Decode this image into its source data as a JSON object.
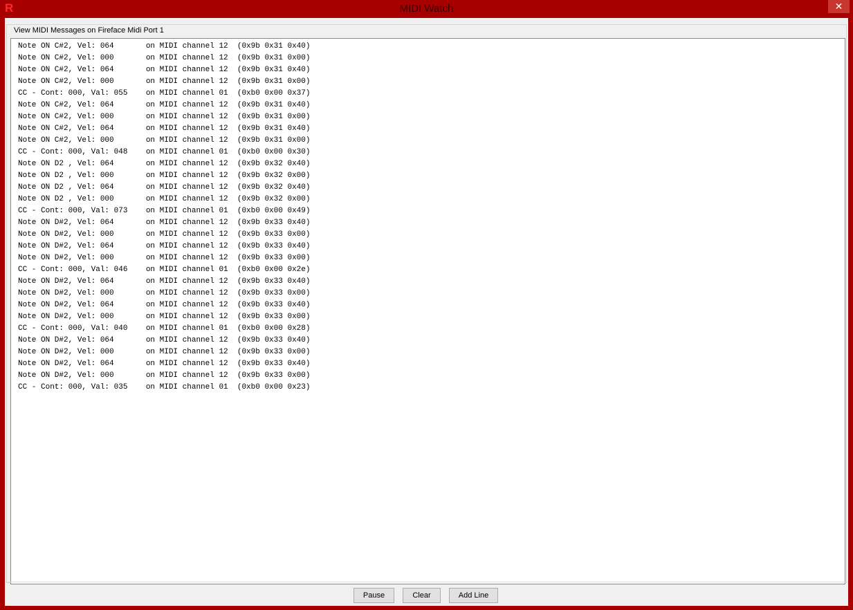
{
  "window": {
    "title": "MIDI Watch",
    "app_icon_glyph": "R",
    "close_glyph": "✕"
  },
  "group": {
    "title": "View MIDI Messages on Fireface Midi Port 1"
  },
  "log": {
    "lines": [
      "Note ON C#2, Vel: 064       on MIDI channel 12  (0x9b 0x31 0x40)",
      "Note ON C#2, Vel: 000       on MIDI channel 12  (0x9b 0x31 0x00)",
      "Note ON C#2, Vel: 064       on MIDI channel 12  (0x9b 0x31 0x40)",
      "Note ON C#2, Vel: 000       on MIDI channel 12  (0x9b 0x31 0x00)",
      "CC - Cont: 000, Val: 055    on MIDI channel 01  (0xb0 0x00 0x37)",
      "Note ON C#2, Vel: 064       on MIDI channel 12  (0x9b 0x31 0x40)",
      "Note ON C#2, Vel: 000       on MIDI channel 12  (0x9b 0x31 0x00)",
      "Note ON C#2, Vel: 064       on MIDI channel 12  (0x9b 0x31 0x40)",
      "Note ON C#2, Vel: 000       on MIDI channel 12  (0x9b 0x31 0x00)",
      "CC - Cont: 000, Val: 048    on MIDI channel 01  (0xb0 0x00 0x30)",
      "Note ON D2 , Vel: 064       on MIDI channel 12  (0x9b 0x32 0x40)",
      "Note ON D2 , Vel: 000       on MIDI channel 12  (0x9b 0x32 0x00)",
      "Note ON D2 , Vel: 064       on MIDI channel 12  (0x9b 0x32 0x40)",
      "Note ON D2 , Vel: 000       on MIDI channel 12  (0x9b 0x32 0x00)",
      "CC - Cont: 000, Val: 073    on MIDI channel 01  (0xb0 0x00 0x49)",
      "Note ON D#2, Vel: 064       on MIDI channel 12  (0x9b 0x33 0x40)",
      "Note ON D#2, Vel: 000       on MIDI channel 12  (0x9b 0x33 0x00)",
      "Note ON D#2, Vel: 064       on MIDI channel 12  (0x9b 0x33 0x40)",
      "Note ON D#2, Vel: 000       on MIDI channel 12  (0x9b 0x33 0x00)",
      "CC - Cont: 000, Val: 046    on MIDI channel 01  (0xb0 0x00 0x2e)",
      "Note ON D#2, Vel: 064       on MIDI channel 12  (0x9b 0x33 0x40)",
      "Note ON D#2, Vel: 000       on MIDI channel 12  (0x9b 0x33 0x00)",
      "Note ON D#2, Vel: 064       on MIDI channel 12  (0x9b 0x33 0x40)",
      "Note ON D#2, Vel: 000       on MIDI channel 12  (0x9b 0x33 0x00)",
      "CC - Cont: 000, Val: 040    on MIDI channel 01  (0xb0 0x00 0x28)",
      "Note ON D#2, Vel: 064       on MIDI channel 12  (0x9b 0x33 0x40)",
      "Note ON D#2, Vel: 000       on MIDI channel 12  (0x9b 0x33 0x00)",
      "Note ON D#2, Vel: 064       on MIDI channel 12  (0x9b 0x33 0x40)",
      "Note ON D#2, Vel: 000       on MIDI channel 12  (0x9b 0x33 0x00)",
      "CC - Cont: 000, Val: 035    on MIDI channel 01  (0xb0 0x00 0x23)"
    ]
  },
  "buttons": {
    "pause": "Pause",
    "clear": "Clear",
    "add_line": "Add Line"
  },
  "colors": {
    "frame": "#a60000",
    "close_button": "#c7372f",
    "client_background": "#f0f0f0"
  }
}
